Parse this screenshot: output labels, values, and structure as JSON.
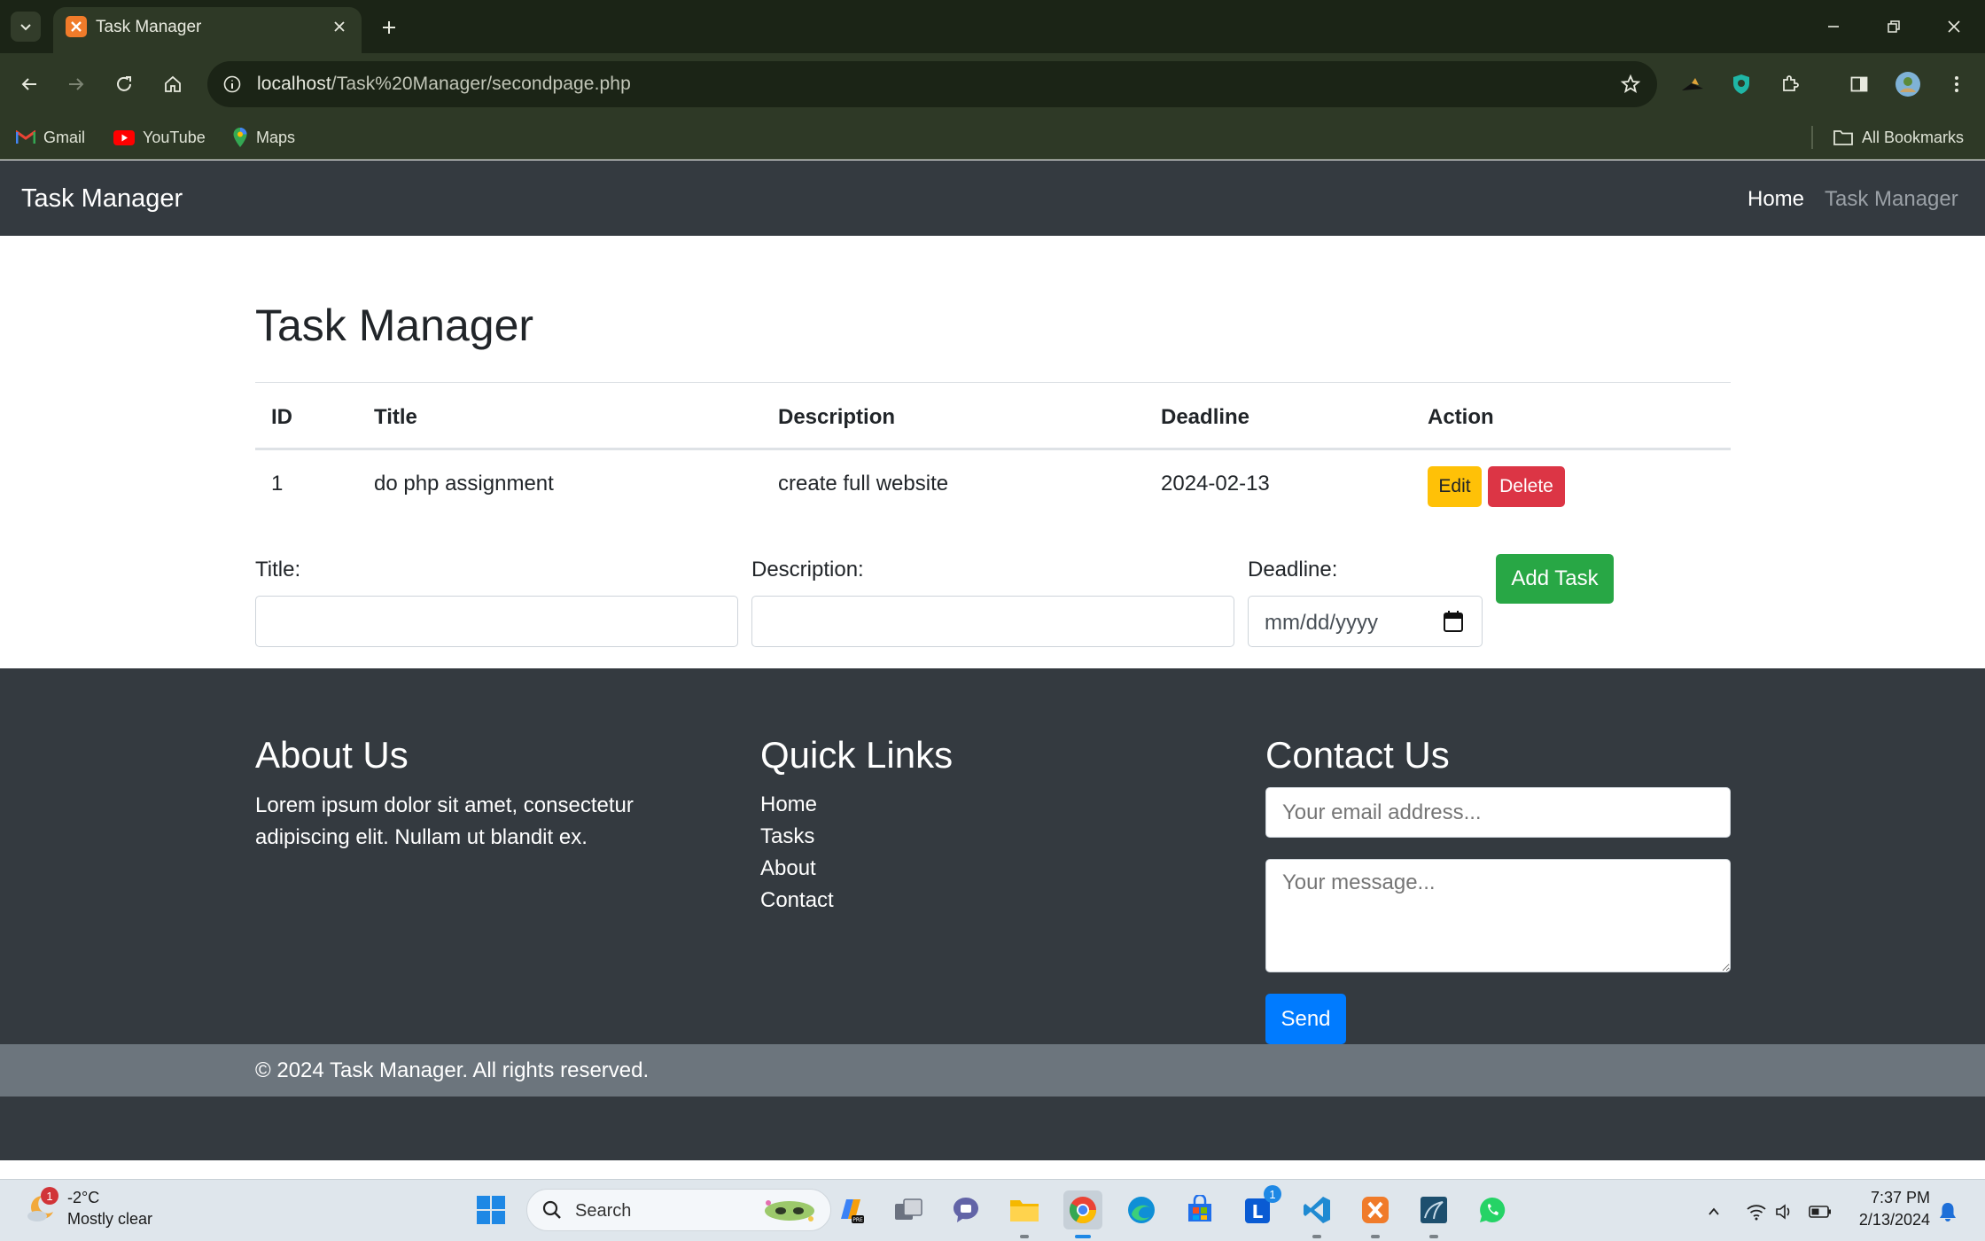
{
  "browser": {
    "tab_title": "Task Manager",
    "url_host": "localhost",
    "url_path": "/Task%20Manager/secondpage.php",
    "bookmarks": [
      "Gmail",
      "YouTube",
      "Maps"
    ],
    "all_bookmarks": "All Bookmarks"
  },
  "navbar": {
    "brand": "Task Manager",
    "links": [
      "Home",
      "Task Manager"
    ]
  },
  "main": {
    "title": "Task Manager",
    "table": {
      "headers": [
        "ID",
        "Title",
        "Description",
        "Deadline",
        "Action"
      ],
      "rows": [
        {
          "id": "1",
          "title": "do php assignment",
          "description": "create full website",
          "deadline": "2024-02-13"
        }
      ],
      "edit_label": "Edit",
      "delete_label": "Delete"
    },
    "form": {
      "title_label": "Title:",
      "description_label": "Description:",
      "deadline_label": "Deadline:",
      "deadline_placeholder": "mm/dd/yyyy",
      "add_label": "Add Task"
    }
  },
  "footer": {
    "about_title": "About Us",
    "about_text": "Lorem ipsum dolor sit amet, consectetur adipiscing elit. Nullam ut blandit ex.",
    "links_title": "Quick Links",
    "links": [
      "Home",
      "Tasks",
      "About",
      "Contact"
    ],
    "contact_title": "Contact Us",
    "email_placeholder": "Your email address...",
    "message_placeholder": "Your message...",
    "send_label": "Send",
    "copyright": "© 2024 Task Manager. All rights reserved."
  },
  "taskbar": {
    "weather_temp": "-2°C",
    "weather_cond": "Mostly clear",
    "weather_badge": "1",
    "search_label": "Search",
    "time": "7:37 PM",
    "date": "2/13/2024",
    "lync_badge": "1"
  },
  "colors": {
    "navbar": "#343a40",
    "success": "#28a745",
    "warning": "#ffc107",
    "danger": "#dc3545",
    "primary": "#007bff",
    "copyright_bar": "#6c757d"
  }
}
